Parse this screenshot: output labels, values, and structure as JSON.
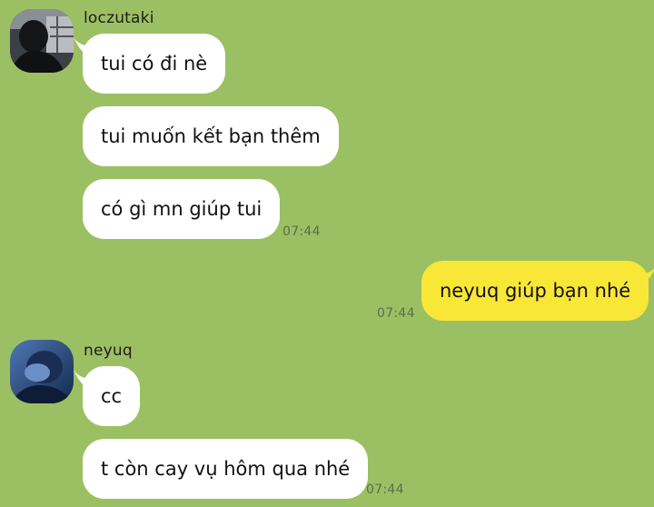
{
  "chat": {
    "groups": [
      {
        "sender": "loczutaki",
        "avatar": "user-photo-silhouette",
        "messages": [
          "tui có đi nè",
          "tui muốn kết bạn thêm",
          "có gì mn giúp tui"
        ],
        "time": "07:44"
      },
      {
        "sender": "me",
        "messages": [
          "neyuq giúp bạn nhé"
        ],
        "time": "07:44"
      },
      {
        "sender": "neyuq",
        "avatar": "user-photo-blue",
        "messages": [
          "cc",
          "t còn cay vụ hôm qua nhé"
        ],
        "time": "07:44"
      }
    ]
  },
  "colors": {
    "background": "#9bc063",
    "incoming_bubble": "#ffffff",
    "outgoing_bubble": "#f9e737"
  }
}
